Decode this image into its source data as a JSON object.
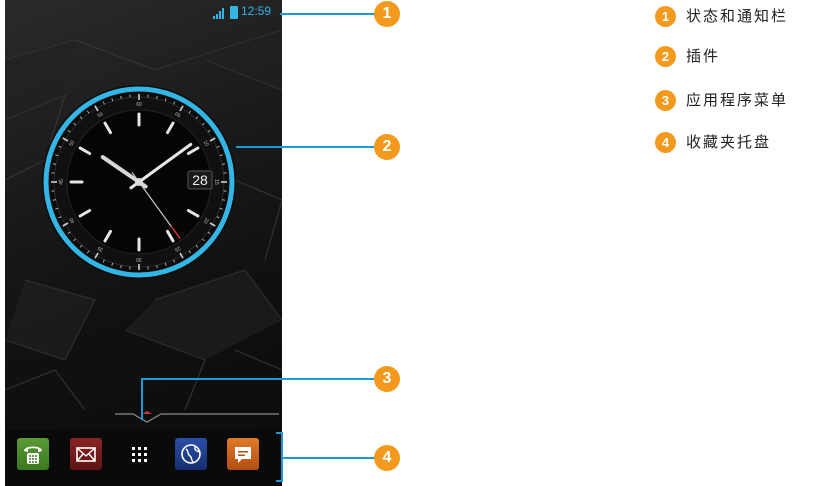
{
  "status_bar": {
    "time": "12:59"
  },
  "clock_widget": {
    "date": "28",
    "dial_numbers": [
      "60",
      "05",
      "10",
      "15",
      "20",
      "25",
      "30",
      "35",
      "40",
      "45",
      "50",
      "55"
    ],
    "time_shown": {
      "hour": 10,
      "minute": 9,
      "second": 24
    }
  },
  "dock": {
    "apps": [
      {
        "name": "phone",
        "icon": "phone-icon",
        "color": "#4a8a2a"
      },
      {
        "name": "messaging",
        "icon": "envelope-icon",
        "color": "#7a1c1c"
      },
      {
        "name": "app-menu",
        "icon": "grid-icon",
        "color": "#0a0a0a"
      },
      {
        "name": "browser",
        "icon": "globe-icon",
        "color": "#1f3c8c"
      },
      {
        "name": "sms",
        "icon": "chat-icon",
        "color": "#d2691e"
      }
    ]
  },
  "callouts": [
    {
      "number": "1",
      "label": "状态和通知栏"
    },
    {
      "number": "2",
      "label": "插件"
    },
    {
      "number": "3",
      "label": "应用程序菜单"
    },
    {
      "number": "4",
      "label": "收藏夹托盘"
    }
  ],
  "colors": {
    "accent": "#33b5e5",
    "badge": "#f39a1e",
    "callout_line": "#1a9ad6"
  }
}
